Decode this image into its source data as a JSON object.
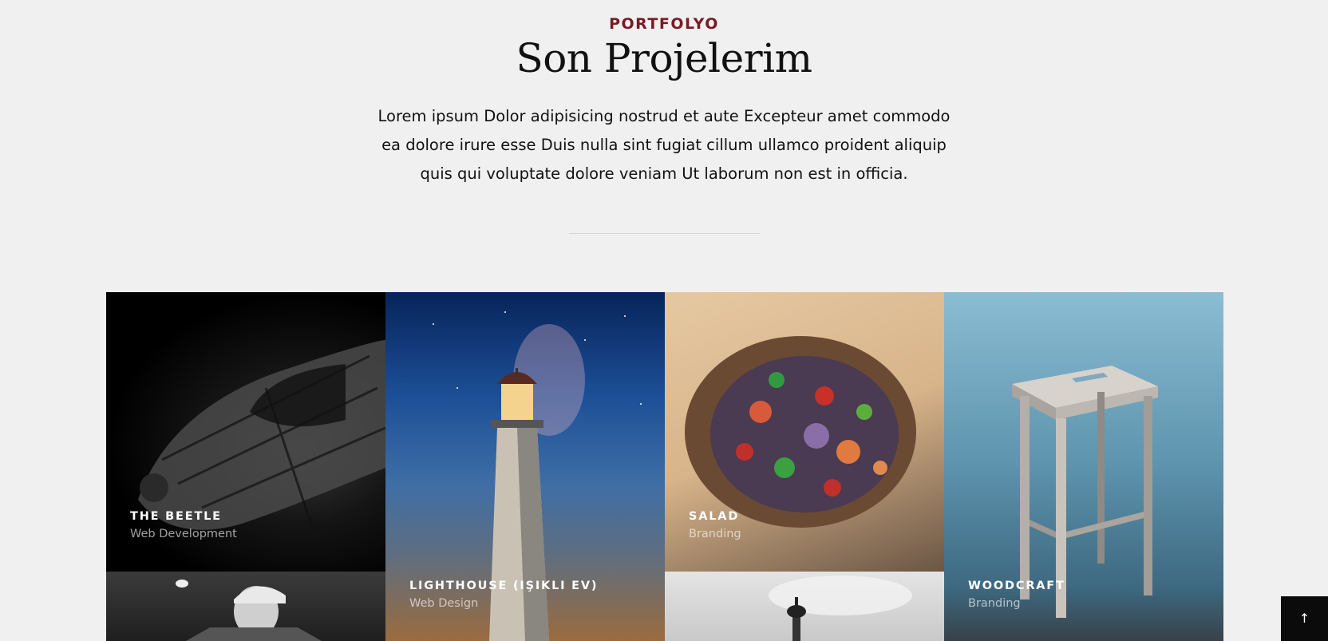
{
  "section": {
    "eyebrow": "PORTFOLYO",
    "title": "Son Projelerim",
    "intro_lines": [
      "Lorem ipsum Dolor adipisicing nostrud et aute Excepteur amet commodo",
      "ea dolore irure esse Duis nulla sint fugiat cillum ullamco proident aliquip",
      "quis qui voluptate dolore veniam Ut laborum non est in officia."
    ]
  },
  "portfolio": {
    "items": [
      {
        "title": "THE BEETLE",
        "category": "Web Development",
        "image": "car-photo"
      },
      {
        "title": "LIGHTHOUSE (IŞIKLI EV)",
        "category": "Web Design",
        "image": "lighthouse-photo"
      },
      {
        "title": "SALAD",
        "category": "Branding",
        "image": "salad-bowl-photo"
      },
      {
        "title": "WOODCRAFT",
        "category": "Branding",
        "image": "wooden-stool-photo"
      },
      {
        "title": "",
        "category": "",
        "image": "person-photo"
      },
      {
        "title": "",
        "category": "",
        "image": "tower-photo"
      }
    ]
  },
  "scroll_top": {
    "icon": "arrow-up-icon",
    "glyph": "↑"
  },
  "colors": {
    "accent": "#7a1a24",
    "background": "#f0f0f0",
    "text": "#111111"
  }
}
